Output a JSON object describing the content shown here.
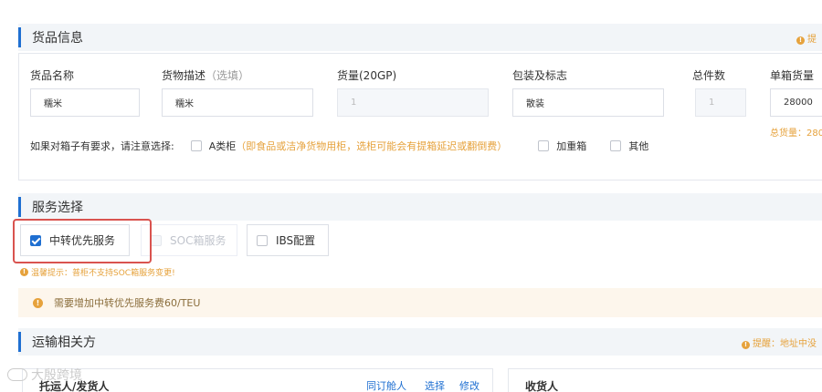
{
  "goods_section": {
    "title": "货品信息",
    "hint": "提",
    "fields": [
      {
        "label": "货品名称",
        "value": "糯米"
      },
      {
        "label": "货物描述",
        "label_optional": "（选填）",
        "value": "糯米"
      },
      {
        "label": "货量(20GP)",
        "value": "1"
      },
      {
        "label": "包装及标志",
        "value": "散装"
      },
      {
        "label": "总件数",
        "value": "1"
      },
      {
        "label": "单箱货量",
        "value": "28000"
      }
    ],
    "total_weight": "总货量：280",
    "container_requirement": {
      "prompt": "如果对箱子有要求，请注意选择:",
      "options": [
        {
          "label": "A类柜",
          "note": "（即食品或洁净货物用柜，选柜可能会有提箱延迟或翻倒费）",
          "checked": false
        },
        {
          "label": "加重箱",
          "checked": false
        },
        {
          "label": "其他",
          "checked": false
        }
      ]
    }
  },
  "service_section": {
    "title": "服务选择",
    "options": [
      {
        "label": "中转优先服务",
        "checked": true,
        "disabled": false
      },
      {
        "label": "SOC箱服务",
        "checked": false,
        "disabled": true
      },
      {
        "label": "IBS配置",
        "checked": false,
        "disabled": false
      }
    ],
    "tip": "温馨提示：普柜不支持SOC箱服务变更!",
    "notice": "需要增加中转优先服务费60/TEU"
  },
  "transport_section": {
    "title": "运输相关方",
    "hint": "提醒：地址中没",
    "shipper_title": "托运人/发货人",
    "shipper_links": [
      "同订舱人",
      "选择",
      "修改"
    ],
    "consignee_title": "收货人"
  },
  "watermark": "大殷跨境",
  "colors": {
    "accent": "#1f6fd1",
    "warning": "#e6a23c",
    "highlight": "#d9534f"
  }
}
